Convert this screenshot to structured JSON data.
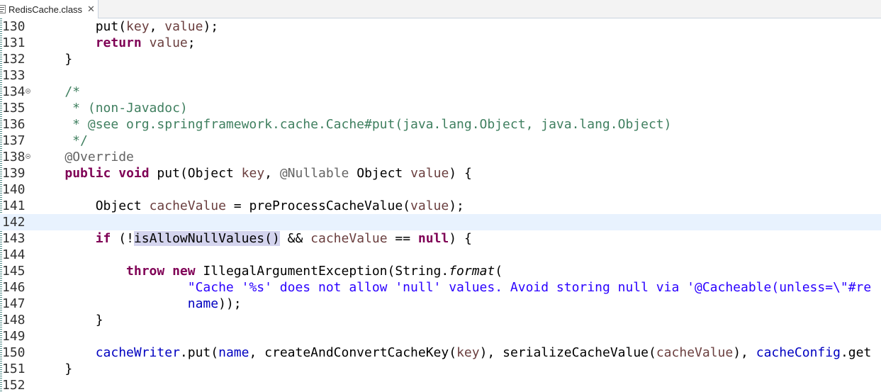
{
  "tab": {
    "title": "RedisCache.class",
    "close": "✕",
    "icon": "class-file-icon"
  },
  "colors": {
    "keyword": "#7f0055",
    "comment": "#3f7f5f",
    "annotation": "#646464",
    "string": "#2a00ff",
    "field": "#0000c0",
    "local": "#6a3e3e",
    "current_line": "#e8f2fe",
    "occurrence": "#d4d4ee"
  },
  "current_line": 142,
  "lines": [
    {
      "n": "130",
      "t": [
        {
          "x": "        put("
        },
        {
          "x": "key",
          "c": "var"
        },
        {
          "x": ", "
        },
        {
          "x": "value",
          "c": "var"
        },
        {
          "x": ");"
        }
      ]
    },
    {
      "n": "131",
      "t": [
        {
          "x": "        "
        },
        {
          "x": "return",
          "c": "kw"
        },
        {
          "x": " "
        },
        {
          "x": "value",
          "c": "var"
        },
        {
          "x": ";"
        }
      ]
    },
    {
      "n": "132",
      "t": [
        {
          "x": "    }"
        }
      ]
    },
    {
      "n": "133",
      "t": []
    },
    {
      "n": "134",
      "fold": true,
      "t": [
        {
          "x": "    "
        },
        {
          "x": "/*",
          "c": "cm"
        }
      ]
    },
    {
      "n": "135",
      "t": [
        {
          "x": "     * (non-Javadoc)",
          "c": "cm"
        }
      ]
    },
    {
      "n": "136",
      "t": [
        {
          "x": "     * @see org.springframework.cache.Cache#put(java.lang.Object, java.lang.Object)",
          "c": "cm"
        }
      ]
    },
    {
      "n": "137",
      "t": [
        {
          "x": "     */",
          "c": "cm"
        }
      ]
    },
    {
      "n": "138",
      "fold": true,
      "t": [
        {
          "x": "    "
        },
        {
          "x": "@Override",
          "c": "ann"
        }
      ]
    },
    {
      "n": "139",
      "t": [
        {
          "x": "    "
        },
        {
          "x": "public",
          "c": "kw"
        },
        {
          "x": " "
        },
        {
          "x": "void",
          "c": "kw"
        },
        {
          "x": " put(Object "
        },
        {
          "x": "key",
          "c": "var"
        },
        {
          "x": ", "
        },
        {
          "x": "@Nullable",
          "c": "ann"
        },
        {
          "x": " Object "
        },
        {
          "x": "value",
          "c": "var"
        },
        {
          "x": ") {"
        }
      ]
    },
    {
      "n": "140",
      "t": []
    },
    {
      "n": "141",
      "t": [
        {
          "x": "        Object "
        },
        {
          "x": "cacheValue",
          "c": "var"
        },
        {
          "x": " = preProcessCacheValue("
        },
        {
          "x": "value",
          "c": "var"
        },
        {
          "x": ");"
        }
      ]
    },
    {
      "n": "142",
      "t": []
    },
    {
      "n": "143",
      "t": [
        {
          "x": "        "
        },
        {
          "x": "if",
          "c": "kw"
        },
        {
          "x": " (!"
        },
        {
          "x": "isAllowNullValues()",
          "c": "hl"
        },
        {
          "x": " && "
        },
        {
          "x": "cacheValue",
          "c": "var"
        },
        {
          "x": " == "
        },
        {
          "x": "null",
          "c": "kw"
        },
        {
          "x": ") {"
        }
      ]
    },
    {
      "n": "144",
      "t": []
    },
    {
      "n": "145",
      "t": [
        {
          "x": "            "
        },
        {
          "x": "throw",
          "c": "kw"
        },
        {
          "x": " "
        },
        {
          "x": "new",
          "c": "kw"
        },
        {
          "x": " IllegalArgumentException(String."
        },
        {
          "x": "format",
          "c": "it"
        },
        {
          "x": "("
        }
      ]
    },
    {
      "n": "146",
      "t": [
        {
          "x": "                    "
        },
        {
          "x": "\"Cache '%s' does not allow 'null' values. Avoid storing null via '@Cacheable(unless=\\\"#re",
          "c": "st"
        }
      ]
    },
    {
      "n": "147",
      "t": [
        {
          "x": "                    "
        },
        {
          "x": "name",
          "c": "fld"
        },
        {
          "x": "));"
        }
      ]
    },
    {
      "n": "148",
      "t": [
        {
          "x": "        }"
        }
      ]
    },
    {
      "n": "149",
      "t": []
    },
    {
      "n": "150",
      "t": [
        {
          "x": "        "
        },
        {
          "x": "cacheWriter",
          "c": "fld"
        },
        {
          "x": ".put("
        },
        {
          "x": "name",
          "c": "fld"
        },
        {
          "x": ", createAndConvertCacheKey("
        },
        {
          "x": "key",
          "c": "var"
        },
        {
          "x": "), serializeCacheValue("
        },
        {
          "x": "cacheValue",
          "c": "var"
        },
        {
          "x": "), "
        },
        {
          "x": "cacheConfig",
          "c": "fld"
        },
        {
          "x": ".get"
        }
      ]
    },
    {
      "n": "151",
      "t": [
        {
          "x": "    }"
        }
      ]
    },
    {
      "n": "152",
      "t": []
    }
  ]
}
